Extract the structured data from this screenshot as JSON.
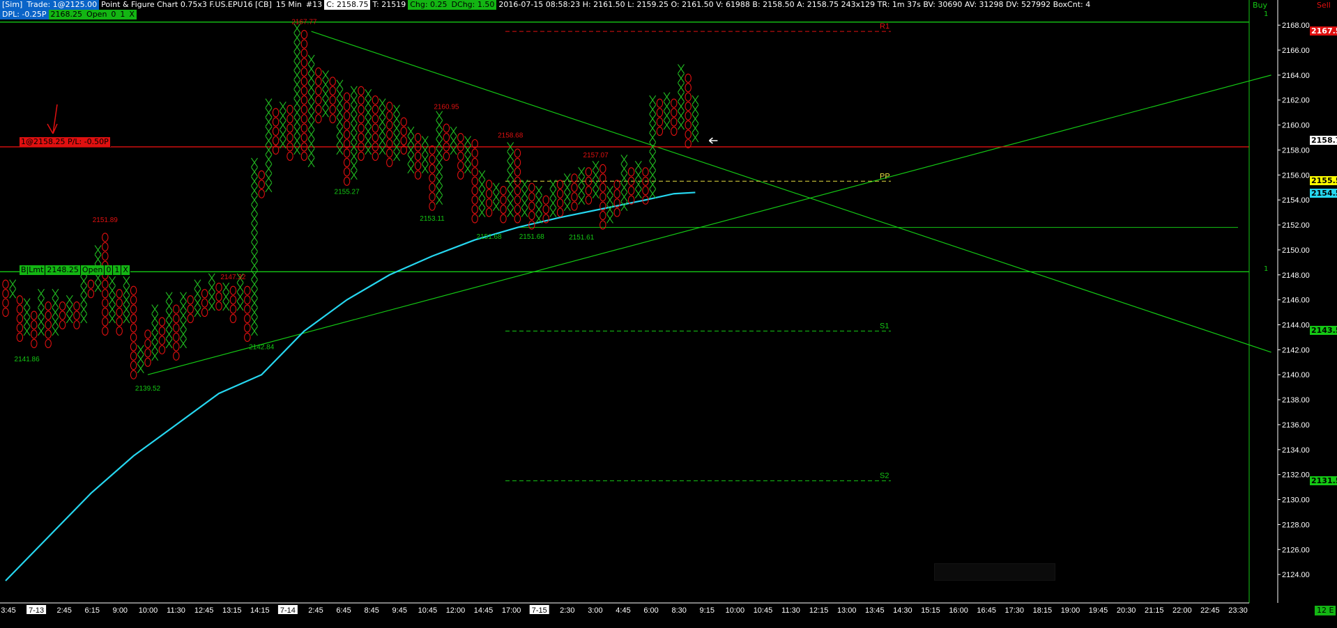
{
  "header": {
    "sim_label": "[Sim]",
    "trade_label": "Trade: 1@2125.00",
    "chart_title": "Point & Figure Chart 0.75x3 F.US.EPU16 [CB]",
    "interval": "15 Min",
    "hash": "#13",
    "close": "C: 2158.75",
    "t_value": "T: 21519",
    "chg": "Chg: 0.25",
    "dchg": "DChg: 1.50",
    "stats": "2016-07-15 08:58:23 H: 2161.50 L: 2159.25 O: 2161.50 V: 61988 B: 2158.50 A: 2158.75 243x129 TR: 1m 37s BV: 30690 AV: 31298 DV: 527992 BoxCnt: 4"
  },
  "dpl": {
    "label": "DPL: -0.25P",
    "price": "2168.25",
    "open": "Open",
    "zero": "0",
    "one": "1",
    "x": "X"
  },
  "position_tag": {
    "text": "1@2158.25 P/L: -0.50P"
  },
  "buy_limit": {
    "label": "B|Lmt",
    "price": "2148.25",
    "open": "Open",
    "zero": "0",
    "one": "1",
    "x": "X"
  },
  "corner": {
    "buy": "Buy",
    "sell": "Sell",
    "tz": "12 E",
    "one_top": "1",
    "one_mid": "1"
  },
  "colors": {
    "x_col": "#22c022",
    "o_col": "#e01010",
    "ma": "#26d7f0",
    "trend": "#14c814",
    "axis": "#ffffff"
  },
  "icons": [
    "position-arrow-icon",
    "current-bar-arrow-icon"
  ],
  "chart_data": {
    "type": "point-and-figure",
    "box_size": 0.75,
    "reversal": 3,
    "ylim": [
      2123,
      2169
    ],
    "y_ticks": [
      2124,
      2126,
      2128,
      2130,
      2132,
      2134,
      2136,
      2138,
      2140,
      2142,
      2144,
      2146,
      2148,
      2150,
      2152,
      2154,
      2156,
      2158,
      2160,
      2162,
      2164,
      2166,
      2168
    ],
    "x_ticks": [
      "3:45",
      "7-13",
      "2:45",
      "6:15",
      "9:00",
      "10:00",
      "11:30",
      "12:45",
      "13:15",
      "14:15",
      "7-14",
      "2:45",
      "6:45",
      "8:45",
      "9:45",
      "10:45",
      "12:00",
      "14:45",
      "17:00",
      "7-15",
      "2:30",
      "3:00",
      "4:45",
      "6:00",
      "8:30",
      "9:15",
      "10:00",
      "10:45",
      "11:30",
      "12:15",
      "13:00",
      "13:45",
      "14:30",
      "15:15",
      "16:00",
      "16:45",
      "17:30",
      "18:15",
      "19:00",
      "19:45",
      "20:30",
      "21:15",
      "22:00",
      "22:45",
      "23:30"
    ],
    "date_ticks": [
      "7-13",
      "7-14",
      "7-15"
    ],
    "columns": [
      {
        "type": "O",
        "high": 2147.5,
        "low": 2145
      },
      {
        "type": "X",
        "high": 2147.5,
        "low": 2146.5
      },
      {
        "type": "O",
        "high": 2146,
        "low": 2143
      },
      {
        "type": "X",
        "high": 2145.5,
        "low": 2143.5
      },
      {
        "type": "O",
        "high": 2144.5,
        "low": 2142.5
      },
      {
        "type": "X",
        "high": 2146.5,
        "low": 2143.5
      },
      {
        "type": "O",
        "high": 2145.5,
        "low": 2142.5
      },
      {
        "type": "X",
        "high": 2146.5,
        "low": 2143.5
      },
      {
        "type": "O",
        "high": 2145.5,
        "low": 2144
      },
      {
        "type": "X",
        "high": 2146,
        "low": 2144.5
      },
      {
        "type": "O",
        "high": 2145.5,
        "low": 2144
      },
      {
        "type": "X",
        "high": 2148.5,
        "low": 2144.5
      },
      {
        "type": "O",
        "high": 2147.5,
        "low": 2146.5
      },
      {
        "type": "X",
        "high": 2150,
        "low": 2147
      },
      {
        "type": "O",
        "high": 2151,
        "low": 2143.5
      },
      {
        "type": "X",
        "high": 2147.5,
        "low": 2144.5
      },
      {
        "type": "O",
        "high": 2146.5,
        "low": 2143.5
      },
      {
        "type": "X",
        "high": 2147.5,
        "low": 2144.5
      },
      {
        "type": "O",
        "high": 2147,
        "low": 2140
      },
      {
        "type": "X",
        "high": 2142,
        "low": 2140.5
      },
      {
        "type": "O",
        "high": 2143,
        "low": 2141
      },
      {
        "type": "X",
        "high": 2145,
        "low": 2141.5
      },
      {
        "type": "O",
        "high": 2144,
        "low": 2142
      },
      {
        "type": "X",
        "high": 2146,
        "low": 2142.5
      },
      {
        "type": "O",
        "high": 2145,
        "low": 2141.5
      },
      {
        "type": "X",
        "high": 2146.5,
        "low": 2142.5
      },
      {
        "type": "O",
        "high": 2146,
        "low": 2144.5
      },
      {
        "type": "X",
        "high": 2147,
        "low": 2145
      },
      {
        "type": "O",
        "high": 2146.5,
        "low": 2145
      },
      {
        "type": "X",
        "high": 2147.5,
        "low": 2145.5
      },
      {
        "type": "O",
        "high": 2147,
        "low": 2145.5
      },
      {
        "type": "X",
        "high": 2147,
        "low": 2145.5
      },
      {
        "type": "O",
        "high": 2146.5,
        "low": 2144.5
      },
      {
        "type": "X",
        "high": 2147.5,
        "low": 2145.5
      },
      {
        "type": "O",
        "high": 2146.5,
        "low": 2143
      },
      {
        "type": "X",
        "high": 2157,
        "low": 2143.5
      },
      {
        "type": "O",
        "high": 2156,
        "low": 2154.5
      },
      {
        "type": "X",
        "high": 2161.5,
        "low": 2155
      },
      {
        "type": "O",
        "high": 2161,
        "low": 2158
      },
      {
        "type": "X",
        "high": 2161.5,
        "low": 2158.5
      },
      {
        "type": "O",
        "high": 2161,
        "low": 2157.5
      },
      {
        "type": "X",
        "high": 2167.5,
        "low": 2158
      },
      {
        "type": "O",
        "high": 2167,
        "low": 2157.5
      },
      {
        "type": "X",
        "high": 2165,
        "low": 2157
      },
      {
        "type": "O",
        "high": 2164.5,
        "low": 2160.5
      },
      {
        "type": "X",
        "high": 2164,
        "low": 2161
      },
      {
        "type": "O",
        "high": 2163.5,
        "low": 2160.5
      },
      {
        "type": "X",
        "high": 2163,
        "low": 2158
      },
      {
        "type": "O",
        "high": 2162.5,
        "low": 2155.5
      },
      {
        "type": "X",
        "high": 2163,
        "low": 2156
      },
      {
        "type": "O",
        "high": 2162.5,
        "low": 2157.5
      },
      {
        "type": "X",
        "high": 2162.5,
        "low": 2158
      },
      {
        "type": "O",
        "high": 2162,
        "low": 2157.5
      },
      {
        "type": "X",
        "high": 2162,
        "low": 2158
      },
      {
        "type": "O",
        "high": 2161.5,
        "low": 2157
      },
      {
        "type": "X",
        "high": 2161,
        "low": 2157.5
      },
      {
        "type": "O",
        "high": 2160.5,
        "low": 2158
      },
      {
        "type": "X",
        "high": 2159.5,
        "low": 2156.5
      },
      {
        "type": "O",
        "high": 2159,
        "low": 2156
      },
      {
        "type": "X",
        "high": 2158.5,
        "low": 2156.5
      },
      {
        "type": "O",
        "high": 2158,
        "low": 2153.5
      },
      {
        "type": "X",
        "high": 2160.5,
        "low": 2154
      },
      {
        "type": "O",
        "high": 2160,
        "low": 2157.5
      },
      {
        "type": "X",
        "high": 2159.5,
        "low": 2158
      },
      {
        "type": "O",
        "high": 2159,
        "low": 2156
      },
      {
        "type": "X",
        "high": 2159,
        "low": 2156.5
      },
      {
        "type": "O",
        "high": 2158.5,
        "low": 2152.5
      },
      {
        "type": "X",
        "high": 2156,
        "low": 2153
      },
      {
        "type": "O",
        "high": 2155.5,
        "low": 2153
      },
      {
        "type": "X",
        "high": 2155,
        "low": 2153.5
      },
      {
        "type": "O",
        "high": 2154.5,
        "low": 2152.5
      },
      {
        "type": "X",
        "high": 2158,
        "low": 2153
      },
      {
        "type": "O",
        "high": 2157.5,
        "low": 2152.5
      },
      {
        "type": "X",
        "high": 2155,
        "low": 2153
      },
      {
        "type": "O",
        "high": 2155,
        "low": 2152
      },
      {
        "type": "X",
        "high": 2154.5,
        "low": 2152.5
      },
      {
        "type": "O",
        "high": 2154,
        "low": 2152.5
      },
      {
        "type": "X",
        "high": 2155.5,
        "low": 2153
      },
      {
        "type": "O",
        "high": 2155,
        "low": 2153
      },
      {
        "type": "X",
        "high": 2156,
        "low": 2153.5
      },
      {
        "type": "O",
        "high": 2155.5,
        "low": 2153.5
      },
      {
        "type": "X",
        "high": 2156.5,
        "low": 2154
      },
      {
        "type": "O",
        "high": 2156,
        "low": 2154
      },
      {
        "type": "X",
        "high": 2157,
        "low": 2154.5
      },
      {
        "type": "O",
        "high": 2156.5,
        "low": 2152
      },
      {
        "type": "X",
        "high": 2155,
        "low": 2152.5
      },
      {
        "type": "O",
        "high": 2155,
        "low": 2153
      },
      {
        "type": "X",
        "high": 2157,
        "low": 2153.5
      },
      {
        "type": "O",
        "high": 2156.5,
        "low": 2154
      },
      {
        "type": "X",
        "high": 2156.5,
        "low": 2154.5
      },
      {
        "type": "O",
        "high": 2156,
        "low": 2154
      },
      {
        "type": "X",
        "high": 2162,
        "low": 2154.5
      },
      {
        "type": "O",
        "high": 2161.5,
        "low": 2159.5
      },
      {
        "type": "X",
        "high": 2162,
        "low": 2160
      },
      {
        "type": "O",
        "high": 2161.5,
        "low": 2159.5
      },
      {
        "type": "X",
        "high": 2164.5,
        "low": 2160
      },
      {
        "type": "O",
        "high": 2164,
        "low": 2158.5
      },
      {
        "type": "X",
        "high": 2162,
        "low": 2159
      }
    ],
    "high_low_labels": [
      {
        "text": "2167.77",
        "col": 42,
        "price": 2167.77,
        "kind": "high"
      },
      {
        "text": "2151.89",
        "col": 14,
        "price": 2151.89,
        "kind": "high"
      },
      {
        "text": "2147.32",
        "col": 32,
        "price": 2147.32,
        "kind": "high"
      },
      {
        "text": "2160.95",
        "col": 62,
        "price": 2160.95,
        "kind": "high"
      },
      {
        "text": "2158.68",
        "col": 71,
        "price": 2158.68,
        "kind": "high"
      },
      {
        "text": "2157.07",
        "col": 83,
        "price": 2157.07,
        "kind": "high"
      },
      {
        "text": "2141.86",
        "col": 3,
        "price": 2141.86,
        "kind": "low"
      },
      {
        "text": "2139.52",
        "col": 20,
        "price": 2139.52,
        "kind": "low"
      },
      {
        "text": "2142.84",
        "col": 36,
        "price": 2142.84,
        "kind": "low"
      },
      {
        "text": "2155.27",
        "col": 48,
        "price": 2155.27,
        "kind": "low"
      },
      {
        "text": "2153.11",
        "col": 60,
        "price": 2153.11,
        "kind": "low"
      },
      {
        "text": "2151.68",
        "col": 68,
        "price": 2151.68,
        "kind": "low"
      },
      {
        "text": "2151.68",
        "col": 74,
        "price": 2151.68,
        "kind": "low"
      },
      {
        "text": "2151.61",
        "col": 81,
        "price": 2151.61,
        "kind": "low"
      }
    ],
    "pivots": [
      {
        "label": "R1",
        "price": 2167.5,
        "color": "#e01010"
      },
      {
        "label": "PP",
        "price": 2155.5,
        "color": "#e8e040"
      },
      {
        "label": "S1",
        "price": 2143.5,
        "color": "#14c814"
      },
      {
        "label": "S2",
        "price": 2131.5,
        "color": "#14c814"
      }
    ],
    "price_boxes": [
      {
        "text": "2167.50",
        "price": 2167.5,
        "bg": "#e01010",
        "fg": "#ffffff"
      },
      {
        "text": "2158.75",
        "price": 2158.75,
        "bg": "#ffffff",
        "fg": "#000000"
      },
      {
        "text": "2155.50",
        "price": 2155.5,
        "bg": "#ffff00",
        "fg": "#000000"
      },
      {
        "text": "2154.51",
        "price": 2154.5,
        "bg": "#26d7f0",
        "fg": "#000000"
      },
      {
        "text": "2143.50",
        "price": 2143.5,
        "bg": "#14c814",
        "fg": "#000000"
      },
      {
        "text": "2131.50",
        "price": 2131.5,
        "bg": "#14c814",
        "fg": "#000000"
      }
    ],
    "position_price": 2158.25,
    "buy_limit_price": 2148.25,
    "top_line_price": 2168.25,
    "support_line_price": 2151.8,
    "trendlines": [
      {
        "from": {
          "col": 20,
          "price": 2140
        },
        "to": {
          "col": 178,
          "price": 2164
        }
      },
      {
        "from": {
          "col": 43,
          "price": 2167.5
        },
        "to": {
          "col": 178,
          "price": 2141.8
        }
      }
    ],
    "moving_average": [
      [
        0,
        2123.5
      ],
      [
        6,
        2127
      ],
      [
        12,
        2130.5
      ],
      [
        18,
        2133.5
      ],
      [
        24,
        2136
      ],
      [
        30,
        2138.5
      ],
      [
        36,
        2140
      ],
      [
        42,
        2143.5
      ],
      [
        48,
        2146
      ],
      [
        54,
        2148
      ],
      [
        60,
        2149.5
      ],
      [
        66,
        2150.8
      ],
      [
        72,
        2151.8
      ],
      [
        78,
        2152.6
      ],
      [
        84,
        2153.3
      ],
      [
        90,
        2154
      ],
      [
        94,
        2154.5
      ],
      [
        97,
        2154.6
      ]
    ]
  }
}
